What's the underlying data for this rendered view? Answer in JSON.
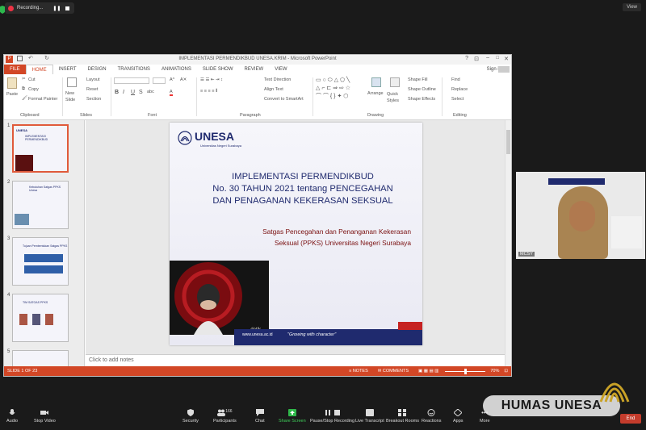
{
  "zoom_top": {
    "recording_label": "Recording...",
    "view_label": "View"
  },
  "ppt": {
    "window_title": "IMPLEMENTASI PERMENDIKBUD UNESA.KRIM - Microsoft PowerPoint",
    "sign_in": "Sign in",
    "tabs": [
      "FILE",
      "HOME",
      "INSERT",
      "DESIGN",
      "TRANSITIONS",
      "ANIMATIONS",
      "SLIDE SHOW",
      "REVIEW",
      "VIEW"
    ],
    "ribbon": {
      "clipboard": {
        "paste": "Paste",
        "cut": "Cut",
        "copy": "Copy",
        "format_painter": "Format Painter",
        "label": "Clipboard"
      },
      "slides": {
        "new_slide": "New Slide",
        "layout": "Layout",
        "reset": "Reset",
        "section": "Section",
        "label": "Slides"
      },
      "font": {
        "label": "Font",
        "bold": "B",
        "italic": "I",
        "underline": "U",
        "strike": "S",
        "shadow": "abc"
      },
      "paragraph": {
        "text_direction": "Text Direction",
        "align_text": "Align Text",
        "smartart": "Convert to SmartArt",
        "label": "Paragraph"
      },
      "drawing": {
        "arrange": "Arrange",
        "quick_styles": "Quick Styles",
        "shape_fill": "Shape Fill",
        "shape_outline": "Shape Outline",
        "shape_effects": "Shape Effects",
        "label": "Drawing"
      },
      "editing": {
        "find": "Find",
        "replace": "Replace",
        "select": "Select",
        "label": "Editing"
      }
    },
    "thumbnails": [
      {
        "num": "1",
        "title": "IMPLEMENTASI PERMENDIKBUD"
      },
      {
        "num": "2",
        "title": "Kebutuhan Satgas PPKS Unesa"
      },
      {
        "num": "3",
        "title": "Tujuan Pembentukan Satgas PPKS"
      },
      {
        "num": "4",
        "title": "TIM SATGAS PPKS"
      },
      {
        "num": "5",
        "title": ""
      }
    ],
    "notes_placeholder": "Click to add notes",
    "status": {
      "slide_of": "SLIDE 1 OF 23",
      "notes": "NOTES",
      "comments": "COMMENTS",
      "zoom": "70%"
    }
  },
  "slide": {
    "logo_text": "UNESA",
    "logo_sub": "Universitas Negeri Surabaya",
    "title_lines": [
      "IMPLEMENTASI PERMENDIKBUD",
      "No. 30 TAHUN 2021 tentang PENCEGAHAN",
      "DAN PENAGANAN KEKERASAN SEKSUAL"
    ],
    "subtitle_lines": [
      "Satgas Pencegahan dan Penanganan Kekerasan",
      "Seksual  (PPKS) Universitas Negeri Surabaya"
    ],
    "image_credit": "detik",
    "url": "www.unesa.ac.id",
    "tagline": "\"Growing with character\""
  },
  "video": {
    "participant_name": "MCSY"
  },
  "zoom_bar": {
    "audio": "Audio",
    "stop_video": "Stop Video",
    "security": "Security",
    "participants": "Participants",
    "participants_count": "166",
    "chat": "Chat",
    "share_screen": "Share Screen",
    "pause_recording": "Pause/Stop Recording",
    "live_transcript": "Live Transcript",
    "breakout_rooms": "Breakout Rooms",
    "reactions": "Reactions",
    "apps": "Apps",
    "more": "More",
    "end": "End"
  },
  "watermark": "HUMAS UNESA",
  "colors": {
    "ppt_accent": "#d24726",
    "unesa_navy": "#1f2a6e",
    "subtitle_red": "#7a1010"
  }
}
